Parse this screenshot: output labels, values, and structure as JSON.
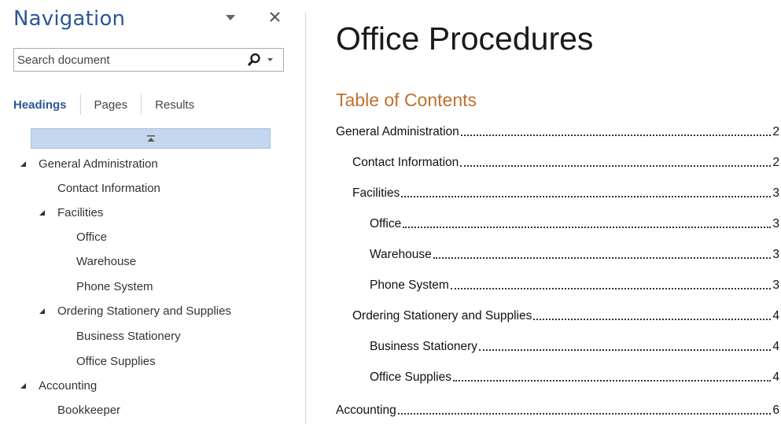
{
  "navigation": {
    "title": "Navigation",
    "search": {
      "placeholder": "Search document",
      "value": ""
    },
    "tabs": [
      {
        "label": "Headings",
        "active": true
      },
      {
        "label": "Pages",
        "active": false
      },
      {
        "label": "Results",
        "active": false
      }
    ],
    "tree": [
      {
        "label": "General Administration",
        "level": 0,
        "expanded": true
      },
      {
        "label": "Contact Information",
        "level": 1,
        "expanded": null
      },
      {
        "label": "Facilities",
        "level": 1,
        "expanded": true
      },
      {
        "label": "Office",
        "level": 2,
        "expanded": null
      },
      {
        "label": "Warehouse",
        "level": 2,
        "expanded": null
      },
      {
        "label": "Phone System",
        "level": 2,
        "expanded": null
      },
      {
        "label": "Ordering Stationery and Supplies",
        "level": 1,
        "expanded": true
      },
      {
        "label": "Business Stationery",
        "level": 2,
        "expanded": null
      },
      {
        "label": "Office Supplies",
        "level": 2,
        "expanded": null
      },
      {
        "label": "Accounting",
        "level": 0,
        "expanded": true
      },
      {
        "label": "Bookkeeper",
        "level": 1,
        "expanded": null
      }
    ]
  },
  "document": {
    "title": "Office Procedures",
    "toc_heading": "Table of Contents",
    "toc": [
      {
        "text": "General Administration",
        "page": "2",
        "level": 0
      },
      {
        "text": "Contact Information",
        "page": "2",
        "level": 1
      },
      {
        "text": "Facilities",
        "page": "3",
        "level": 1
      },
      {
        "text": "Office",
        "page": "3",
        "level": 2
      },
      {
        "text": "Warehouse",
        "page": "3",
        "level": 2
      },
      {
        "text": "Phone System",
        "page": "3",
        "level": 2
      },
      {
        "text": "Ordering Stationery and Supplies",
        "page": "4",
        "level": 1
      },
      {
        "text": "Business Stationery",
        "page": "4",
        "level": 2
      },
      {
        "text": "Office Supplies",
        "page": "4",
        "level": 2
      },
      {
        "text": "Accounting",
        "page": "6",
        "level": 0
      }
    ]
  },
  "colors": {
    "accent": "#2b579a",
    "toc_heading": "#c0702f",
    "selection": "#c5d7ef"
  },
  "icons": {
    "menu": "triangle-down-icon",
    "close": "close-icon",
    "search": "magnifier-icon",
    "collapse_all": "collapse-up-icon",
    "expand_toggle": "triangle-expanded-icon"
  }
}
